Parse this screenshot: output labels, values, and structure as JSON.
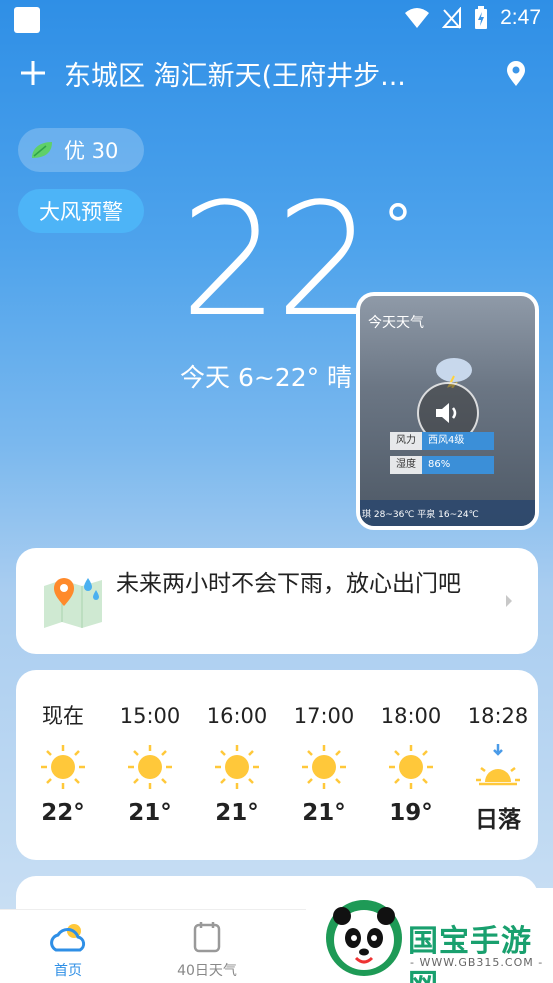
{
  "status_bar": {
    "time": "2:47"
  },
  "header": {
    "location": "东城区 淘汇新天(王府井步..."
  },
  "badges": {
    "aqi": "优 30",
    "warning": "大风预警"
  },
  "current": {
    "temperature": "22",
    "degree": "°",
    "today_range": "今天 6~22° 晴"
  },
  "video": {
    "title": "今天天气",
    "rows": [
      {
        "label": "风力",
        "value": "西风4级"
      },
      {
        "label": "湿度",
        "value": "86%"
      }
    ],
    "footer": "琪 28~36℃  平泉 16~24℃",
    "speaker_icon": "speaker-icon"
  },
  "rain_card": {
    "text": "未来两小时不会下雨，放心出门吧",
    "icon": "map-icon"
  },
  "hourly": [
    {
      "time": "现在",
      "icon": "sun-icon",
      "temp": "22°"
    },
    {
      "time": "15:00",
      "icon": "sun-icon",
      "temp": "21°"
    },
    {
      "time": "16:00",
      "icon": "sun-icon",
      "temp": "21°"
    },
    {
      "time": "17:00",
      "icon": "sun-icon",
      "temp": "21°"
    },
    {
      "time": "18:00",
      "icon": "sun-icon",
      "temp": "19°"
    },
    {
      "time": "18:28",
      "icon": "sunset-icon",
      "temp": "日落"
    }
  ],
  "nav": [
    {
      "label": "首页",
      "icon": "home-weather-icon",
      "active": true
    },
    {
      "label": "40日天气",
      "icon": "calendar-icon",
      "active": false
    }
  ],
  "watermark": {
    "brand": "国宝手游网",
    "url": "- WWW.GB315.COM -"
  },
  "colors": {
    "accent": "#2f8fe6",
    "sun": "#ffc83a",
    "warning_bg": "#4db4f7"
  }
}
